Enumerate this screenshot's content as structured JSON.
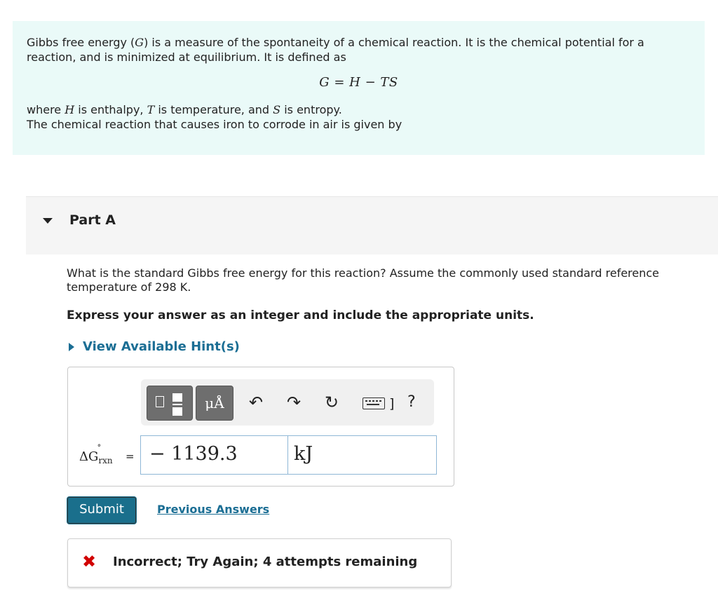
{
  "intro": {
    "paragraph1": "Gibbs free energy (G) is a measure of the spontaneity of a chemical reaction. It is the chemical potential for a reaction, and is minimized at equilibrium. It is defined as",
    "formula": "G = H − TS",
    "where": "where H is enthalpy, T is temperature, and S is entropy.",
    "cutoff": "The chemical reaction that causes iron to corrode in air is given by"
  },
  "part": {
    "title": "Part A"
  },
  "question": {
    "text": "What is the standard Gibbs free energy for this reaction? Assume the commonly used standard reference temperature of 298 K.",
    "instruction": "Express your answer as an integer and include the appropriate units.",
    "hint_link": "View Available Hint(s)"
  },
  "toolbar": {
    "unit_button": "μÅ",
    "undo_icon": "undo-icon",
    "redo_icon": "redo-icon",
    "reset_icon": "reset-icon",
    "keyboard_icon": "keyboard-icon",
    "bracket": "]",
    "help": "?"
  },
  "answer": {
    "label": "ΔG°rxn",
    "equals": "=",
    "value": "− 1139.3",
    "unit": "kJ"
  },
  "actions": {
    "submit": "Submit",
    "previous_answers": "Previous Answers"
  },
  "feedback": {
    "icon": "✖",
    "text": "Incorrect; Try Again; 4 attempts remaining"
  },
  "colors": {
    "intro_bg": "#eafaf8",
    "link": "#1b6e94",
    "submit_bg": "#1a6f8c",
    "error": "#d10000"
  }
}
